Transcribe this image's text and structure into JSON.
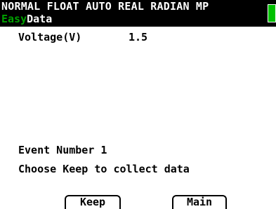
{
  "status_bar": {
    "mode_text": "NORMAL FLOAT AUTO REAL RADIAN MP",
    "app_name": "Easy",
    "screen_title": "Data",
    "battery_color": "#00c000"
  },
  "sensor": {
    "label": "Voltage(V)",
    "value": "1.5"
  },
  "event": {
    "text": "Event Number 1"
  },
  "prompt": {
    "text": "Choose Keep to collect data"
  },
  "softkeys": {
    "keep_label": "Keep",
    "main_label": "Main"
  },
  "colors": {
    "app_name": "#00a000",
    "status_background": "#000000",
    "screen_background": "#ffffff"
  }
}
